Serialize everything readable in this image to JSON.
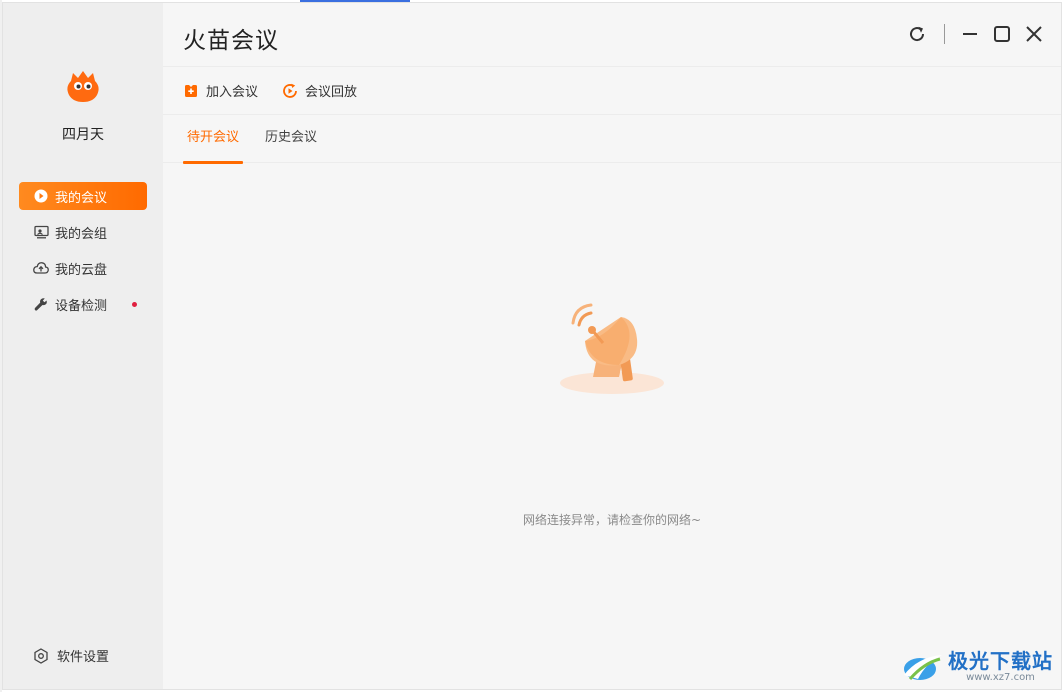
{
  "app": {
    "title": "火苗会议"
  },
  "user": {
    "name": "四月天"
  },
  "sidebar": {
    "items": [
      {
        "label": "我的会议",
        "icon": "play-circle-icon",
        "active": true
      },
      {
        "label": "我的会组",
        "icon": "group-screen-icon",
        "active": false
      },
      {
        "label": "我的云盘",
        "icon": "cloud-upload-icon",
        "active": false
      },
      {
        "label": "设备检测",
        "icon": "wrench-icon",
        "active": false,
        "badge": "red-dot"
      }
    ],
    "settings_label": "软件设置"
  },
  "toolbar": {
    "join_label": "加入会议",
    "playback_label": "会议回放"
  },
  "tabs": [
    {
      "label": "待开会议",
      "active": true
    },
    {
      "label": "历史会议",
      "active": false
    }
  ],
  "empty_state": {
    "message": "网络连接异常，请检查你的网络~",
    "icon": "satellite-dish-icon"
  },
  "watermark": {
    "title": "极光下载站",
    "url": "www.xz7.com"
  },
  "colors": {
    "accent": "#ff6a00",
    "sidebar_bg": "#eeeeee",
    "main_bg": "#f6f6f6",
    "notification": "#e02040"
  }
}
